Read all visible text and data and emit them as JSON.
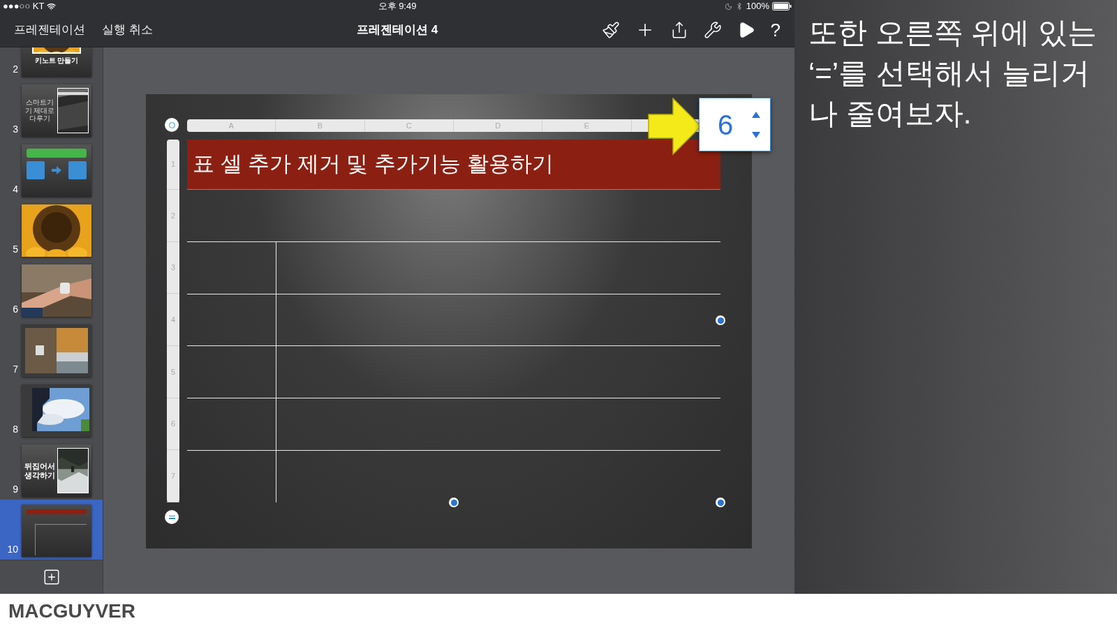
{
  "status_bar": {
    "carrier": "●●●○○ KT",
    "time": "오후 9:49",
    "battery": "100%"
  },
  "toolbar": {
    "left_buttons": [
      "프레젠테이션",
      "실행 취소"
    ],
    "title": "프레젠테이션 4",
    "help": "?"
  },
  "slides": [
    {
      "number": "2",
      "kind": "photo_caption",
      "caption": "키노트 만들기",
      "selected": false
    },
    {
      "number": "3",
      "kind": "text_photo",
      "caption": "스마트기기 제대로 다루기",
      "selected": false
    },
    {
      "number": "4",
      "kind": "diagram",
      "selected": false
    },
    {
      "number": "5",
      "kind": "picture",
      "selected": false
    },
    {
      "number": "6",
      "kind": "picture",
      "selected": false
    },
    {
      "number": "7",
      "kind": "picture",
      "selected": false
    },
    {
      "number": "8",
      "kind": "picture",
      "selected": false
    },
    {
      "number": "9",
      "kind": "text_photo",
      "caption": "뒤집어서 생각하기",
      "selected": false
    },
    {
      "number": "10",
      "kind": "table",
      "selected": true
    }
  ],
  "table": {
    "columns": [
      "A",
      "B",
      "C",
      "D",
      "E"
    ],
    "rows": [
      "1",
      "2",
      "3",
      "4",
      "5",
      "6",
      "7"
    ],
    "title": "표 셀 추가 제거 및 추가기능 활용하기"
  },
  "row_stepper": {
    "value": "6"
  },
  "annotation": "또한 오른쪽 위에 있는 ‘=’를 선택해서 늘리거나 줄여보자.",
  "footer": {
    "logo": "MACGUYVER"
  }
}
